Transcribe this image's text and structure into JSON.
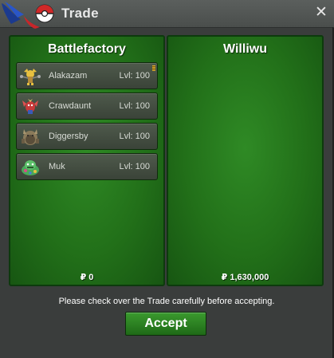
{
  "window": {
    "title": "Trade",
    "close_glyph": "✕",
    "title_icon": "pokeball-logo-icon"
  },
  "left_panel": {
    "name": "Battlefactory",
    "money": "₽ 0",
    "items": [
      {
        "name": "Alakazam",
        "level": "Lvl: 100",
        "icon": "alakazam-sprite-icon"
      },
      {
        "name": "Crawdaunt",
        "level": "Lvl: 100",
        "icon": "crawdaunt-sprite-icon"
      },
      {
        "name": "Diggersby",
        "level": "Lvl: 100",
        "icon": "diggersby-sprite-icon"
      },
      {
        "name": "Muk",
        "level": "Lvl: 100",
        "icon": "muk-sprite-icon"
      }
    ]
  },
  "right_panel": {
    "name": "Williwu",
    "money": "₽ 1,630,000",
    "items": []
  },
  "footer": {
    "notice": "Please check over the Trade carefully before accepting.",
    "accept_label": "Accept"
  },
  "colors": {
    "panel_green": "#227019",
    "panel_border": "#0d3a0d",
    "button_green": "#2f8a25",
    "window_bg": "#3a3d3c"
  }
}
